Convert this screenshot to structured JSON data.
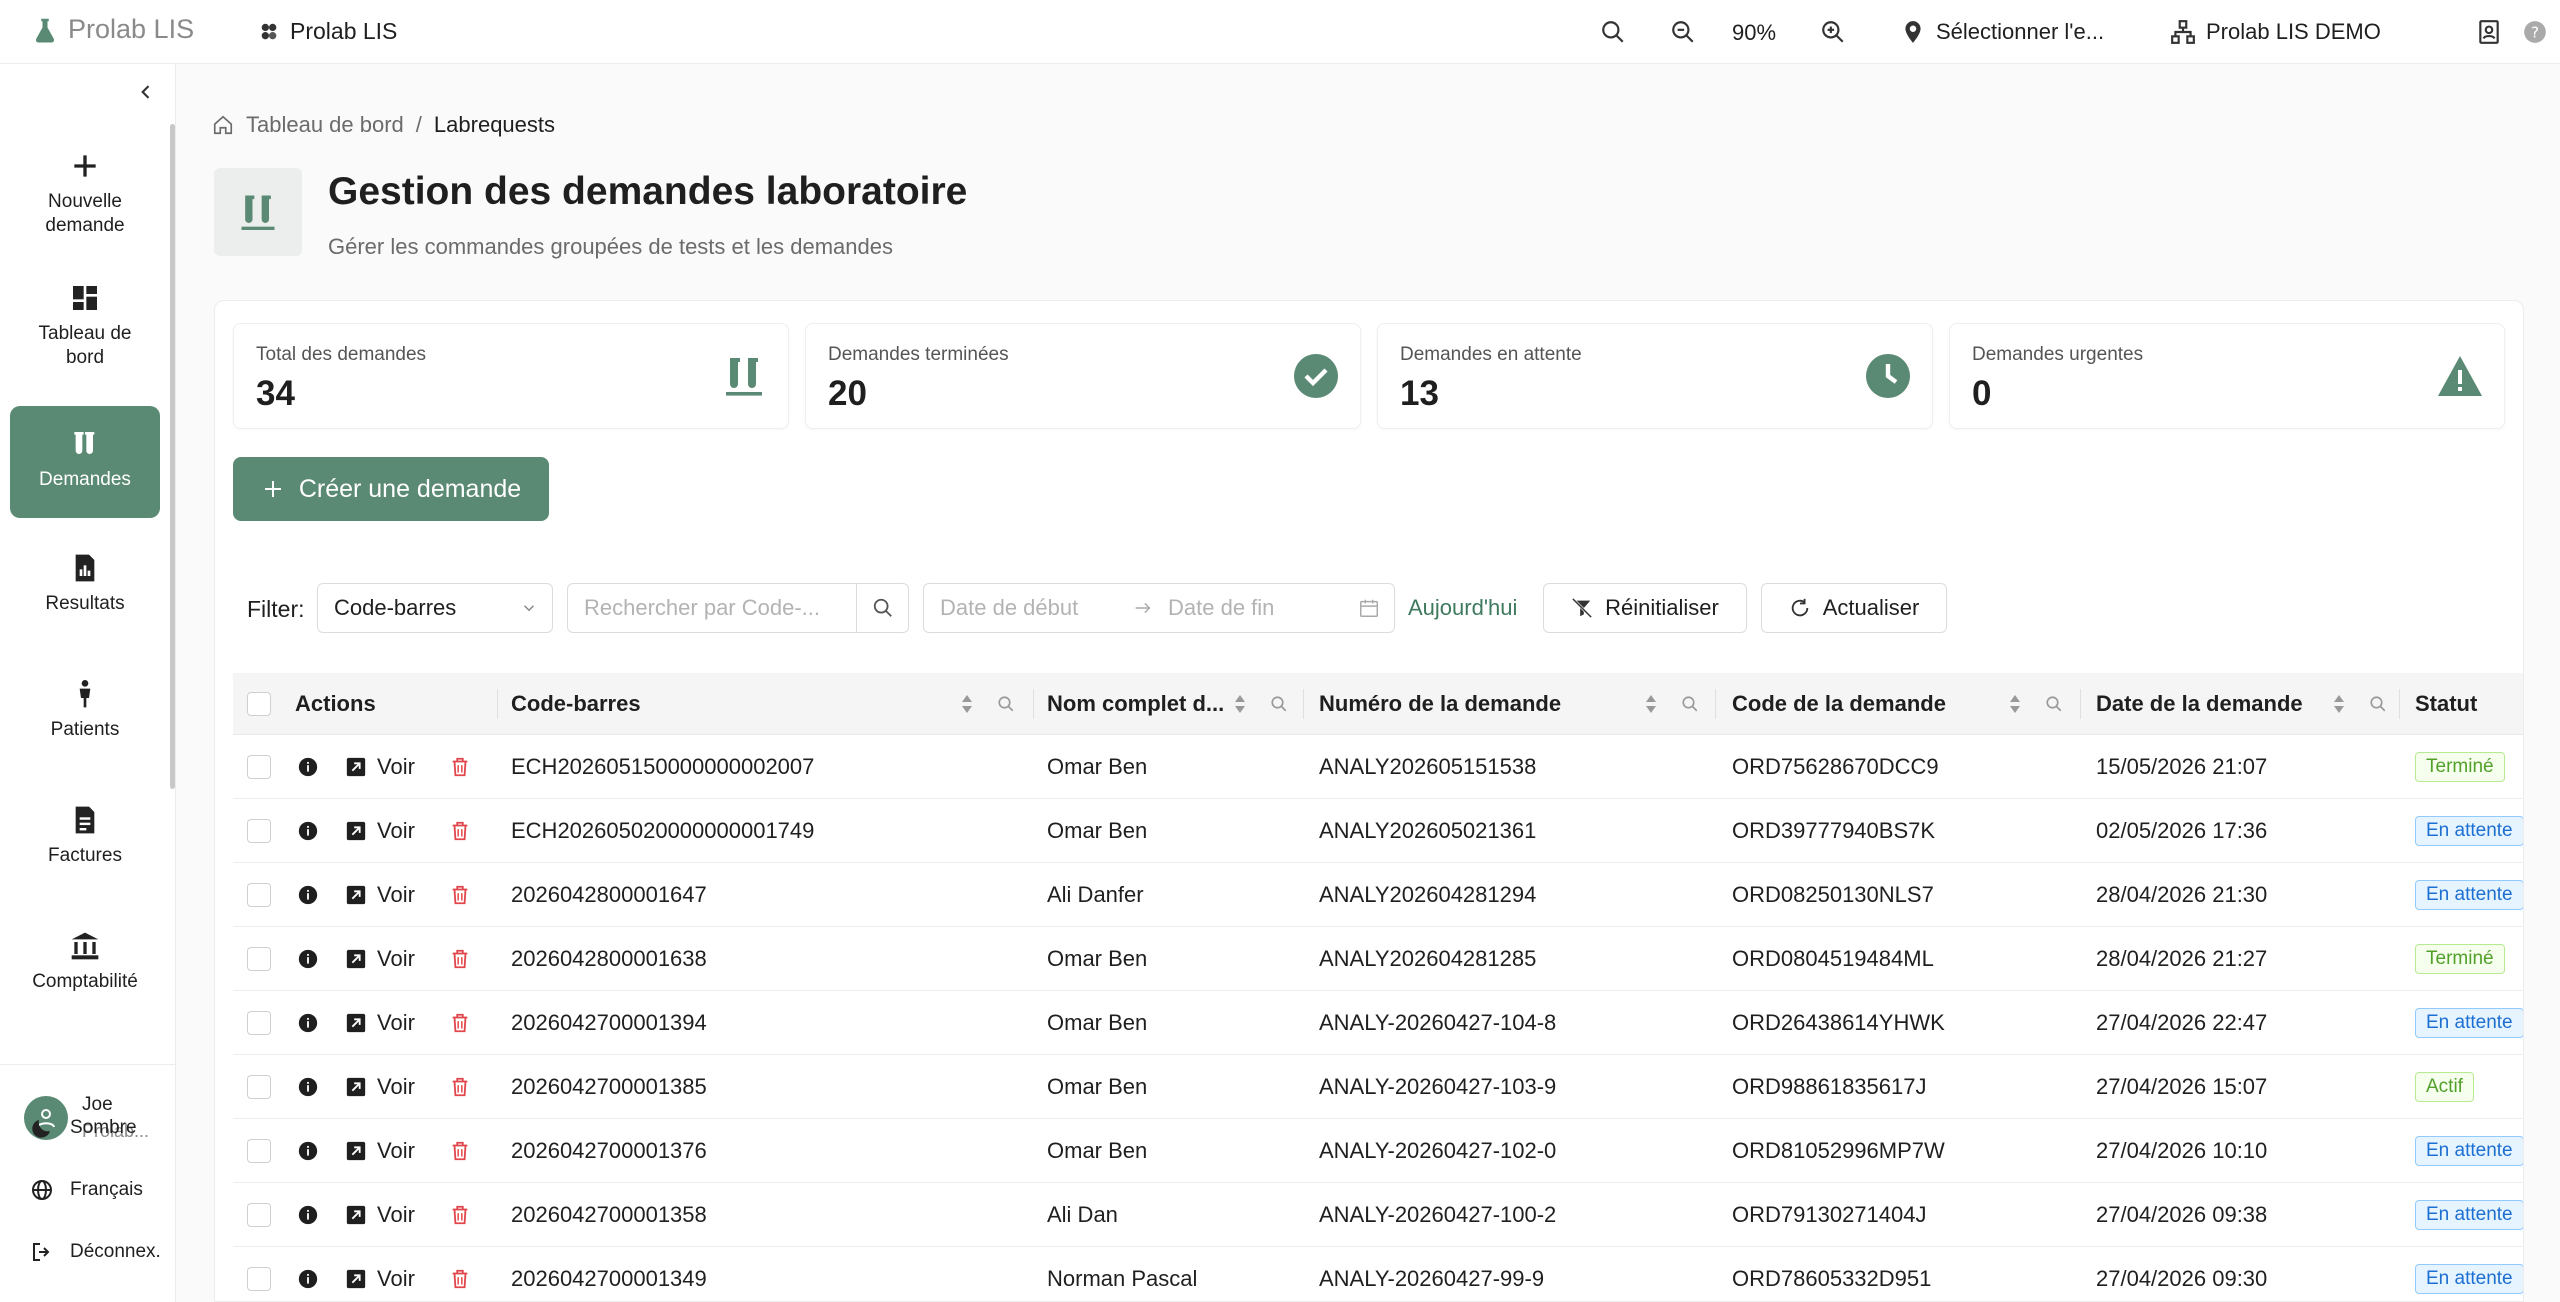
{
  "app": {
    "brand": "Prolab LIS",
    "tenant": "Prolab LIS"
  },
  "topbar": {
    "zoom": "90%",
    "location": "Sélectionner l'e...",
    "org": "Prolab LIS DEMO"
  },
  "sidebar": {
    "items": [
      {
        "label": "Nouvelle demande"
      },
      {
        "label": "Tableau de bord"
      },
      {
        "label": "Demandes"
      },
      {
        "label": "Resultats"
      },
      {
        "label": "Patients"
      },
      {
        "label": "Factures"
      },
      {
        "label": "Comptabilité"
      }
    ],
    "user": {
      "name": "Joe",
      "org": "Prolab..."
    },
    "theme": "Sombre",
    "language": "Français",
    "logout": "Déconnex."
  },
  "breadcrumb": {
    "home": "Tableau de bord",
    "separator": "/",
    "current": "Labrequests"
  },
  "page": {
    "title": "Gestion des demandes laboratoire",
    "subtitle": "Gérer les commandes groupées de tests et les demandes"
  },
  "stats": [
    {
      "label": "Total des demandes",
      "value": "34",
      "icon": "test-tubes-icon"
    },
    {
      "label": "Demandes terminées",
      "value": "20",
      "icon": "check-circle-icon"
    },
    {
      "label": "Demandes en attente",
      "value": "13",
      "icon": "clock-icon"
    },
    {
      "label": "Demandes urgentes",
      "value": "0",
      "icon": "warning-icon"
    }
  ],
  "create_button": "Créer une demande",
  "filter": {
    "label": "Filter:",
    "field": "Code-barres",
    "search_placeholder": "Rechercher par Code-...",
    "date_start": "Date de début",
    "date_end": "Date de fin",
    "today": "Aujourd'hui",
    "reset": "Réinitialiser",
    "refresh": "Actualiser"
  },
  "table": {
    "columns": [
      "Actions",
      "Code-barres",
      "Nom complet d...",
      "Numéro de la demande",
      "Code de la demande",
      "Date de la demande",
      "Statut"
    ],
    "view_label": "Voir",
    "rows": [
      {
        "barcode": "ECH202605150000000002007",
        "name": "Omar Ben",
        "number": "ANALY202605151538",
        "code": "ORD75628670DCC9",
        "date": "15/05/2026 21:07",
        "status": "Terminé",
        "kind": "done"
      },
      {
        "barcode": "ECH202605020000000001749",
        "name": "Omar Ben",
        "number": "ANALY202605021361",
        "code": "ORD39777940BS7K",
        "date": "02/05/2026 17:36",
        "status": "En attente",
        "kind": "wait"
      },
      {
        "barcode": "2026042800001647",
        "name": "Ali Danfer",
        "number": "ANALY202604281294",
        "code": "ORD08250130NLS7",
        "date": "28/04/2026 21:30",
        "status": "En attente",
        "kind": "wait"
      },
      {
        "barcode": "2026042800001638",
        "name": "Omar Ben",
        "number": "ANALY202604281285",
        "code": "ORD0804519484ML",
        "date": "28/04/2026 21:27",
        "status": "Terminé",
        "kind": "done"
      },
      {
        "barcode": "2026042700001394",
        "name": "Omar Ben",
        "number": "ANALY-20260427-104-8",
        "code": "ORD26438614YHWK",
        "date": "27/04/2026 22:47",
        "status": "En attente",
        "kind": "wait"
      },
      {
        "barcode": "2026042700001385",
        "name": "Omar Ben",
        "number": "ANALY-20260427-103-9",
        "code": "ORD98861835617J",
        "date": "27/04/2026 15:07",
        "status": "Actif",
        "kind": "active"
      },
      {
        "barcode": "2026042700001376",
        "name": "Omar Ben",
        "number": "ANALY-20260427-102-0",
        "code": "ORD81052996MP7W",
        "date": "27/04/2026 10:10",
        "status": "En attente",
        "kind": "wait"
      },
      {
        "barcode": "2026042700001358",
        "name": "Ali Dan",
        "number": "ANALY-20260427-100-2",
        "code": "ORD79130271404J",
        "date": "27/04/2026 09:38",
        "status": "En attente",
        "kind": "wait"
      },
      {
        "barcode": "2026042700001349",
        "name": "Norman Pascal",
        "number": "ANALY-20260427-99-9",
        "code": "ORD78605332D951",
        "date": "27/04/2026 09:30",
        "status": "En attente",
        "kind": "wait"
      }
    ]
  },
  "colors": {
    "accent": "#5a8a73",
    "link": "#3f7a5e"
  }
}
